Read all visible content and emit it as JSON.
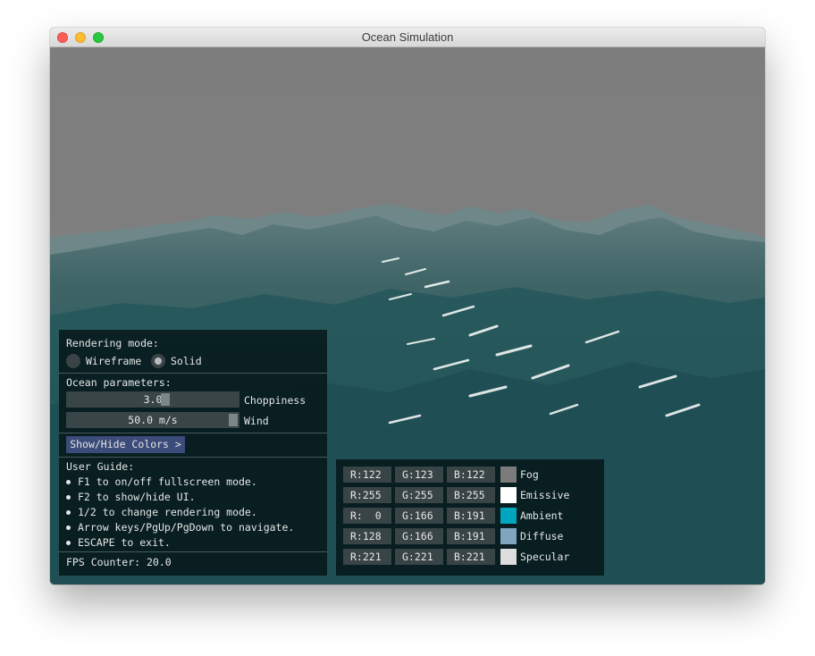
{
  "window": {
    "title": "Ocean Simulation"
  },
  "ui": {
    "rendering_mode": {
      "label": "Rendering mode:",
      "options": [
        "Wireframe",
        "Solid"
      ],
      "selected": "Solid"
    },
    "ocean_parameters": {
      "label": "Ocean parameters:",
      "choppiness": {
        "label": "Choppiness",
        "value": "3.0",
        "level": 0.58
      },
      "wind": {
        "label": "Wind",
        "value": "50.0 m/s",
        "level": 1.0
      }
    },
    "colors_button": "Show/Hide Colors >",
    "user_guide": {
      "label": "User Guide:",
      "items": [
        "F1 to on/off fullscreen mode.",
        "F2 to show/hide UI.",
        "1/2 to change rendering mode.",
        "Arrow keys/PgUp/PgDown to navigate.",
        "ESCAPE to exit."
      ]
    },
    "fps": "FPS Counter: 20.0"
  },
  "colors": [
    {
      "name": "Fog",
      "r": "R:122",
      "g": "G:123",
      "b": "B:122",
      "hex": "#7a7b7a"
    },
    {
      "name": "Emissive",
      "r": "R:255",
      "g": "G:255",
      "b": "B:255",
      "hex": "#ffffff"
    },
    {
      "name": "Ambient",
      "r": "R:  0",
      "g": "G:166",
      "b": "B:191",
      "hex": "#00a6bf"
    },
    {
      "name": "Diffuse",
      "r": "R:128",
      "g": "G:166",
      "b": "B:191",
      "hex": "#80a6bf"
    },
    {
      "name": "Specular",
      "r": "R:221",
      "g": "G:221",
      "b": "B:221",
      "hex": "#dddddd"
    }
  ]
}
